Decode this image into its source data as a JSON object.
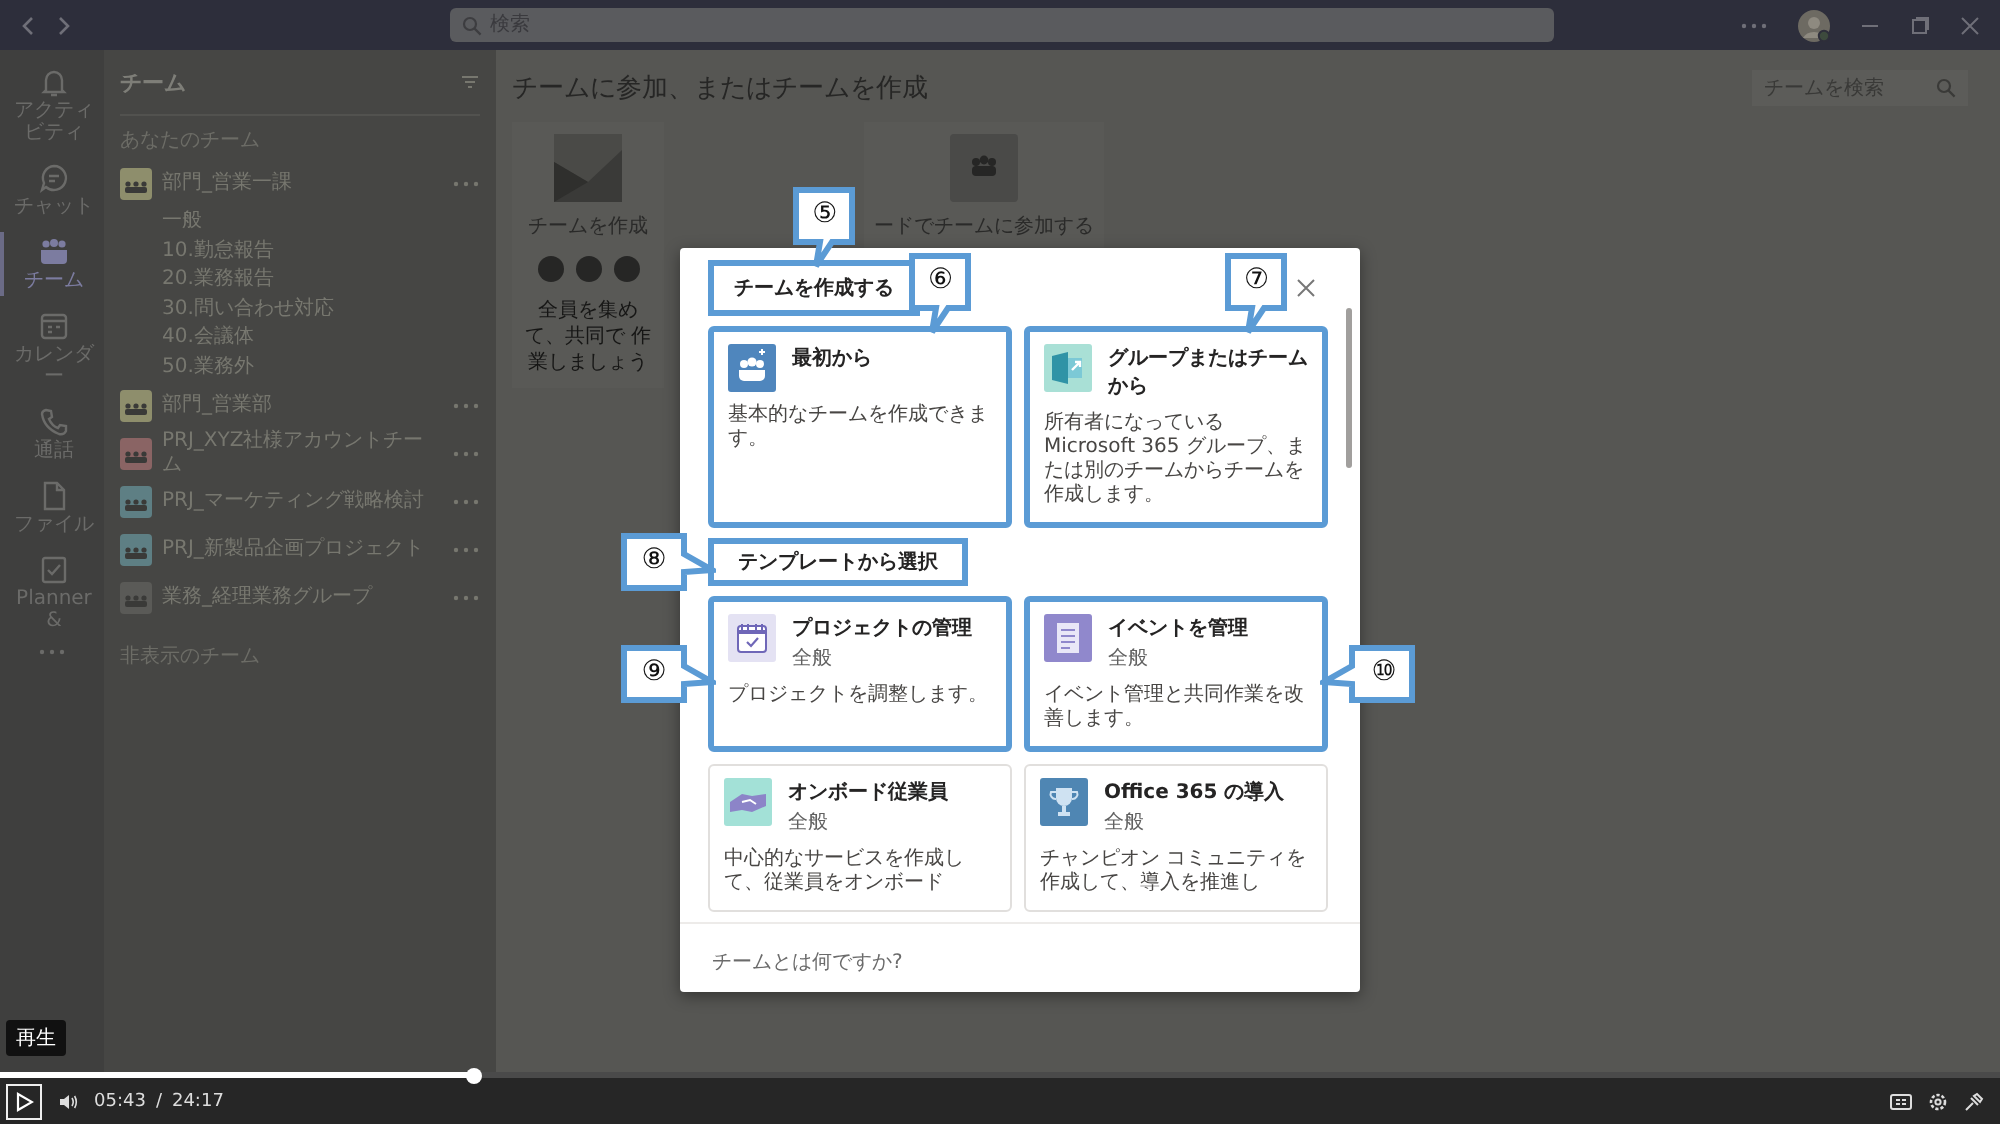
{
  "topbar": {
    "search": {
      "placeholder": "検索"
    }
  },
  "rail": [
    {
      "label": "アクティビティ",
      "selected": false
    },
    {
      "label": "チャット",
      "selected": false
    },
    {
      "label": "チーム",
      "selected": true
    },
    {
      "label": "カレンダー",
      "selected": false
    },
    {
      "label": "通話",
      "selected": false
    },
    {
      "label": "ファイル",
      "selected": false
    },
    {
      "label": "Planner &",
      "selected": false
    }
  ],
  "team_list": {
    "title": "チーム",
    "heading": "あなたのチーム",
    "teams": [
      {
        "name": "部門_営業一課",
        "color": "#8e8e6c",
        "channels": [
          "一般",
          "10.勤怠報告",
          "20.業務報告",
          "30.問い合わせ対応",
          "40.会議体",
          "50.業務外"
        ]
      },
      {
        "name": "部門_営業部",
        "color": "#8e8e6c"
      },
      {
        "name": "PRJ_XYZ社様アカウントチーム",
        "color": "#8a6464"
      },
      {
        "name": "PRJ_マーケティング戦略検討",
        "color": "#5e7f84"
      },
      {
        "name": "PRJ_新製品企画プロジェクト",
        "color": "#5e7f84"
      },
      {
        "name": "業務_経理業務グループ",
        "color": "#5a5a57"
      }
    ],
    "hidden_heading": "非表示のチーム"
  },
  "main": {
    "title": "チームに参加、またはチームを作成",
    "search": {
      "placeholder": "チームを検索"
    },
    "options": [
      {
        "kind": "create",
        "label": "チームを作成",
        "description": "全員を集めて、共同で 作業しましょう"
      },
      {
        "kind": "join",
        "label": "ードでチームに参加する"
      }
    ]
  },
  "dialog": {
    "title": {
      "text": "チームを作成する",
      "highlighted": true,
      "callout": "⑤"
    },
    "cards": [
      {
        "title": "最初から",
        "description": "基本的なチームを作成できます。",
        "color": "#4f86bd",
        "highlighted": true,
        "callout": "⑥"
      },
      {
        "title": "グループまたはチームから",
        "description": "所有者になっている Microsoft 365 グループ、または別のチームからチームを作成します。",
        "color": "#a9e0d6",
        "highlighted": true,
        "callout": "⑦"
      }
    ],
    "section": {
      "text": "テンプレートから選択",
      "highlighted": true,
      "callout": "⑧"
    },
    "templates": [
      {
        "title": "プロジェクトの管理",
        "subtitle": "全般",
        "description": "プロジェクトを調整します。",
        "color": "#e4e2f3",
        "highlighted": true,
        "callout": "⑨"
      },
      {
        "title": "イベントを管理",
        "subtitle": "全般",
        "description": "イベント管理と共同作業を改善します。",
        "color": "#9088cc",
        "highlighted": true,
        "callout": "⑩"
      },
      {
        "title": "オンボード従業員",
        "subtitle": "全般",
        "description": "中心的なサービスを作成して、従業員をオンボード",
        "color": "#a3e1d7",
        "highlighted": false
      },
      {
        "title": "Office 365 の導入",
        "subtitle": "全般",
        "description": "チャンピオン コミュニティを作成して、導入を推進し",
        "color": "#4f86b3",
        "highlighted": false
      }
    ],
    "footer_link": "チームとは何ですか?"
  },
  "player": {
    "tooltip": "再生",
    "playing": false,
    "level": 0.237,
    "current": "05:43",
    "separator": "/",
    "duration": "24:17"
  }
}
